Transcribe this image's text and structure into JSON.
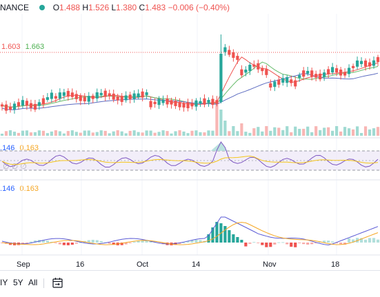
{
  "header": {
    "exchange_fragment": "NANCE",
    "open_label": "O",
    "open": "1.488",
    "high_label": "H",
    "high": "1.526",
    "low_label": "L",
    "low": "1.380",
    "close_label": "C",
    "close": "1.483",
    "change": "−0.006 (−0.40%)"
  },
  "colors": {
    "up": "#26a69a",
    "down": "#ef5350",
    "ma_short": "#ef5350",
    "ma_mid": "#66bb6a",
    "ma_long": "#5c6bc0",
    "rsi": "#7e57c2",
    "rsi_ma": "#f5c518",
    "macd": "#5b5bd6",
    "signal": "#f5a623",
    "price_line": "#ef5350",
    "ohlc_value": "#ef5350",
    "header_dot": "#26a69a"
  },
  "ma_legend": {
    "v1": "1.603",
    "v2": "1.663"
  },
  "rsi_legend": {
    "v1": "146",
    "v2": "0.163",
    "zeros": "∅ ∅ ∅"
  },
  "macd_legend": {
    "v1": "146",
    "v2": "0.163"
  },
  "x_axis": [
    "Sep",
    "16",
    "Oct",
    "14",
    "Nov",
    "18"
  ],
  "toolbar": {
    "range_1y_fragment": "IY",
    "range_5y": "5Y",
    "range_all": "All",
    "calendar_icon": "calendar-range-icon"
  },
  "chart_data": [
    {
      "type": "candlestick",
      "title": "",
      "x": [
        "Sep",
        "16",
        "Oct",
        "14",
        "Nov",
        "18"
      ],
      "series": [
        {
          "name": "price",
          "open": [
            1.488
          ],
          "high": [
            1.526
          ],
          "low": [
            1.38
          ],
          "close": [
            1.483
          ]
        },
        {
          "name": "",
          "values": [
            1.603
          ]
        },
        {
          "name": "",
          "values": [
            1.663
          ]
        }
      ],
      "legend": "top-left"
    },
    {
      "type": "bar",
      "title": "",
      "series": [
        {
          "name": "volume"
        }
      ]
    },
    {
      "type": "line",
      "title": "",
      "series": [
        {
          "name": "",
          "values": [
            0.146
          ]
        },
        {
          "name": "",
          "values": [
            0.163
          ]
        }
      ]
    },
    {
      "type": "bar",
      "title": "",
      "series": [
        {
          "name": "",
          "values": [
            0.146
          ]
        },
        {
          "name": "",
          "values": [
            0.163
          ]
        }
      ]
    }
  ]
}
